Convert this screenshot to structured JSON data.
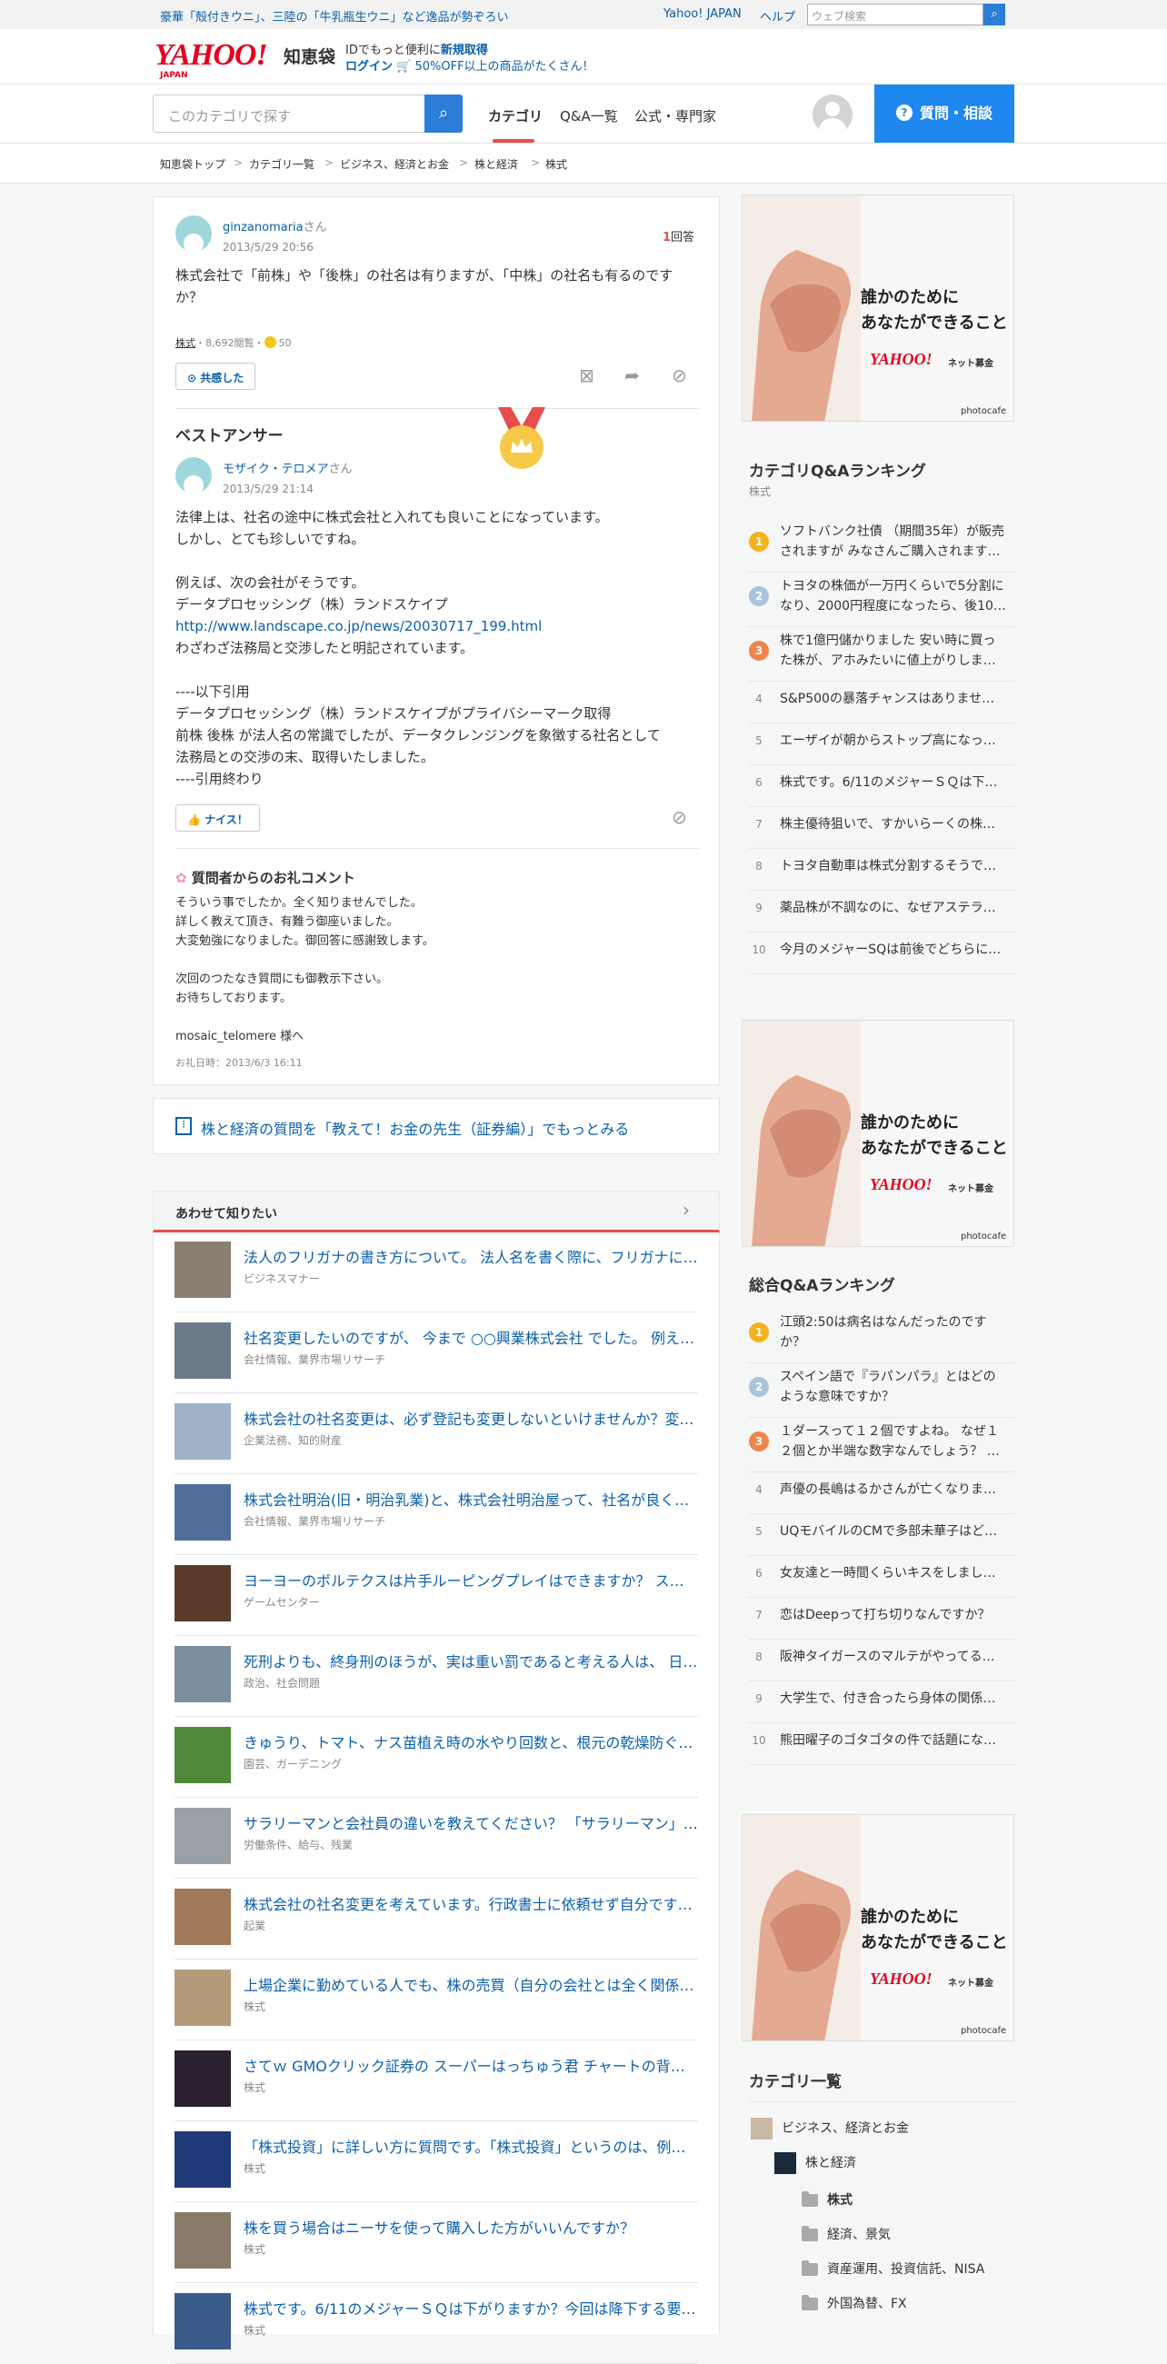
{
  "topbar": {
    "promo": "豪華「殻付きウニ」、三陸の「牛乳瓶生ウニ」など逸品が勢ぞろい",
    "yahoo_japan": "Yahoo! JAPAN",
    "help": "ヘルプ",
    "web_search_placeholder": "ウェブ検索"
  },
  "header": {
    "logo": "YAHOO!",
    "logo_sub": "JAPAN",
    "service": "知恵袋",
    "line1_prefix": "IDでもっと便利に",
    "line1_link": "新規取得",
    "line2_login": "ログイン",
    "line2_text": "🛒 50%OFF以上の商品がたくさん！"
  },
  "nav": {
    "search_placeholder": "このカテゴリで探す",
    "tabs": [
      "カテゴリ",
      "Q&A一覧",
      "公式・専門家"
    ],
    "ask_button": "質問・相談"
  },
  "breadcrumb": [
    "知恵袋トップ",
    "カテゴリ一覧",
    "ビジネス、経済とお金",
    "株と経済",
    "株式"
  ],
  "question": {
    "user": "ginzanomaria",
    "honorific": "さん",
    "date": "2013/5/29 20:56",
    "answer_count": "1",
    "answer_label": "回答",
    "text": "株式会社で「前株」や「後株」の社名は有りますが、「中株」の社名も有るのですか？",
    "tag": "株式",
    "views": "・8,692閲覧・",
    "coins": "50",
    "empathy_button": "共感した"
  },
  "best_answer": {
    "heading": "ベストアンサー",
    "user": "モザイク・テロメア",
    "honorific": "さん",
    "date": "2013/5/29 21:14",
    "lines": [
      "法律上は、社名の途中に株式会社と入れても良いことになっています。",
      "しかし、とても珍しいですね。",
      "",
      "例えば、次の会社がそうです。",
      "データプロセッシング（株）ランドスケイプ",
      "",
      "わざわざ法務局と交渉したと明記されています。",
      "",
      "----以下引用",
      "データプロセッシング（株）ランドスケイプがプライバシーマーク取得",
      "前株 後株 が法人名の常識でしたが、データクレンジングを象徴する社名として",
      "法務局との交渉の末、取得いたしました。",
      "----引用終わり"
    ],
    "link": "http://www.landscape.co.jp/news/20030717_199.html",
    "nice_button": "ナイス！",
    "comment_heading": "質問者からのお礼コメント",
    "comment_lines": [
      "そういう事でしたか。全く知りませんでした。",
      "詳しく教えて頂き、有難う御座いました。",
      "大変勉強になりました。御回答に感謝致します。",
      "",
      "次回のつたなき質問にも御教示下さい。",
      "お待ちしております。",
      "",
      "mosaic_telomere 様へ"
    ],
    "comment_date": "お礼日時：2013/6/3 16:11"
  },
  "promo_link": "株と経済の質問を「教えて！お金の先生（証券編）」でもっとみる",
  "related": {
    "heading": "あわせて知りたい",
    "items": [
      {
        "title": "法人のフリガナの書き方について。 法人名を書く際に、フリガナに…",
        "cat": "ビジネスマナー"
      },
      {
        "title": "社名変更したいのですが、 今まで ○○興業株式会社 でした。 例えば…",
        "cat": "会社情報、業界市場リサーチ"
      },
      {
        "title": "株式会社の社名変更は、必ず登記も変更しないといけませんか？変…",
        "cat": "企業法務、知的財産"
      },
      {
        "title": "株式会社明治(旧・明治乳業)と、株式会社明治屋って、社名が良く…",
        "cat": "会社情報、業界市場リサーチ"
      },
      {
        "title": "ヨーヨーのボルテクスは片手ルーピングプレイはできますか？ スト…",
        "cat": "ゲームセンター"
      },
      {
        "title": "死刑よりも、終身刑のほうが、実は重い罰であると考える人は、 日…",
        "cat": "政治、社会問題"
      },
      {
        "title": "きゅうり、トマト、ナス苗植え時の水やり回数と、根元の乾燥防ぐ…",
        "cat": "園芸、ガーデニング"
      },
      {
        "title": "サラリーマンと会社員の違いを教えてください？ 「サラリーマン」…",
        "cat": "労働条件、給与、残業"
      },
      {
        "title": "株式会社の社名変更を考えています。行政書士に依頼せず自分です…",
        "cat": "起業"
      },
      {
        "title": "上場企業に勤めている人でも、株の売買（自分の会社とは全く関係…",
        "cat": "株式"
      },
      {
        "title": "さてｗ GMOクリック証券の スーパーはっちゅう君 チャートの背景…",
        "cat": "株式"
      },
      {
        "title": "「株式投資」に詳しい方に質問です。「株式投資」というのは、例…",
        "cat": "株式"
      },
      {
        "title": "株を買う場合はニーサを使って購入した方がいいんですか？",
        "cat": "株式"
      },
      {
        "title": "株式です。6/11のメジャーＳＱは下がりますか？今回は降下する要…",
        "cat": "株式"
      }
    ]
  },
  "ads": {
    "line1": "誰かのために",
    "line2": "あなたができること",
    "brand": "YAHOO!",
    "brand_sub": "ネット募金",
    "credit": "photocafe"
  },
  "category_ranking": {
    "heading": "カテゴリQ&Aランキング",
    "sub": "株式",
    "items": [
      {
        "n": "1",
        "text": "ソフトバンク社債 （期間35年）が販売されますが みなさんご購入されます…"
      },
      {
        "n": "2",
        "text": "トヨタの株価が一万円くらいで5分割になり、2000円程度になったら、後10…"
      },
      {
        "n": "3",
        "text": "株で1億円儲かりました 安い時に買った株が、アホみたいに値上がりしま…"
      },
      {
        "n": "4",
        "text": "S&P500の暴落チャンスはありません…"
      },
      {
        "n": "5",
        "text": "エーザイが朝からストップ高になっ…"
      },
      {
        "n": "6",
        "text": "株式です。6/11のメジャーＳＱは下…"
      },
      {
        "n": "7",
        "text": "株主優待狙いで、すかいらーくの株…"
      },
      {
        "n": "8",
        "text": "トヨタ自動車は株式分割するそうで…"
      },
      {
        "n": "9",
        "text": "薬品株が不調なのに、なぜアステラ…"
      },
      {
        "n": "10",
        "text": "今月のメジャーSQは前後でどちらに…"
      }
    ]
  },
  "overall_ranking": {
    "heading": "総合Q&Aランキング",
    "items": [
      {
        "n": "1",
        "text": "江頭2:50は病名はなんだったのですか？"
      },
      {
        "n": "2",
        "text": "スペイン語で『ラパンパラ』とはどのような意味ですか？"
      },
      {
        "n": "3",
        "text": "１ダースって１２個ですよね。 なぜ１２個とか半端な数字なんでしょう？ …"
      },
      {
        "n": "4",
        "text": "声優の長嶋はるかさんが亡くなりま…"
      },
      {
        "n": "5",
        "text": "UQモバイルのCMで多部未華子はど…"
      },
      {
        "n": "6",
        "text": "女友達と一時間くらいキスをしまし…"
      },
      {
        "n": "7",
        "text": "恋はDeepって打ち切りなんですか？"
      },
      {
        "n": "8",
        "text": "阪神タイガースのマルテがやってる…"
      },
      {
        "n": "9",
        "text": "大学生で、付き合ったら身体の関係…"
      },
      {
        "n": "10",
        "text": "熊田曜子のゴタゴタの件で話題にな…"
      }
    ]
  },
  "category_list": {
    "heading": "カテゴリ一覧",
    "items": [
      "ビジネス、経済とお金",
      "株と経済",
      "株式",
      "経済、景気",
      "資産運用、投資信託、NISA",
      "外国為替、FX"
    ]
  },
  "colors": {
    "accent_blue": "#1e88f0",
    "link": "#0b5fab",
    "rank1": "#f5b21b",
    "rank2": "#a9c4dd",
    "rank3": "#f0844b",
    "tab_underline": "#e64d4d"
  }
}
